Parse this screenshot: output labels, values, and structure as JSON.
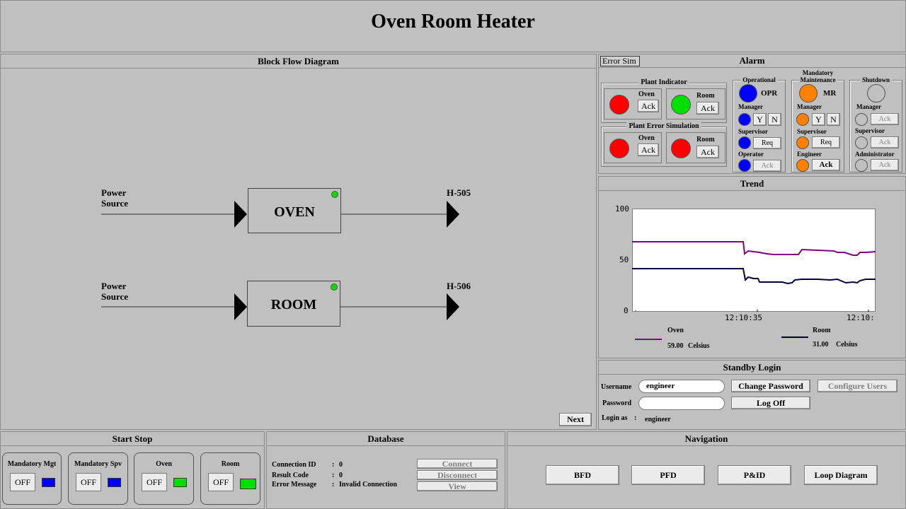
{
  "title": "Oven Room Heater",
  "bfd": {
    "title": "Block Flow Diagram",
    "line1": {
      "source_line1": "Power",
      "source_line2": "Source",
      "block": "OVEN",
      "tag": "H-505"
    },
    "line2": {
      "source_line1": "Power",
      "source_line2": "Source",
      "block": "ROOM",
      "tag": "H-506"
    },
    "next_label": "Next"
  },
  "alarm": {
    "title": "Alarm",
    "error_sim_tab": "Error Sim",
    "plant_indicator": {
      "title": "Plant Indicator",
      "oven": "Oven",
      "room": "Room",
      "ack": "Ack"
    },
    "plant_error_simulation": {
      "title": "Plant Error Simulation",
      "oven": "Oven",
      "room": "Room",
      "ack": "Ack"
    },
    "operational": {
      "title": "Operational",
      "code": "OPR",
      "manager": "Manager",
      "supervisor": "Supervisor",
      "operator": "Operator",
      "y": "Y",
      "n": "N",
      "req": "Req",
      "ack": "Ack"
    },
    "mandatory": {
      "title_line1": "Mandatory",
      "title_line2": "Maintenance",
      "code": "MR",
      "manager": "Manager",
      "supervisor": "Supervisor",
      "engineer": "Engineer",
      "y": "Y",
      "n": "N",
      "req": "Req",
      "ack": "Ack"
    },
    "shutdown": {
      "title": "Shutdown",
      "manager": "Manager",
      "supervisor": "Supervisor",
      "administrator": "Administrator",
      "ack": "Ack"
    },
    "colors": {
      "red": "#ff0000",
      "green": "#00e000",
      "blue": "#0000ff",
      "orange": "#ff8000",
      "grey": "#c0c0c0"
    }
  },
  "trend": {
    "title": "Trend",
    "y_ticks": [
      "100",
      "50",
      "0"
    ],
    "x_ticks": [
      "12:10:35",
      "12:10:"
    ],
    "legend": {
      "oven_label": "Oven",
      "oven_value": "59.00",
      "oven_unit": "Celsius",
      "room_label": "Room",
      "room_value": "31.00",
      "room_unit": "Celsius"
    },
    "colors": {
      "oven": "#800080",
      "room": "#000040"
    }
  },
  "login": {
    "title": "Standby Login",
    "username_label": "Username",
    "username_value": "engineer",
    "password_label": "Password",
    "password_value": "",
    "change_password": "Change Password",
    "configure_users": "Configure Users",
    "log_off": "Log Off",
    "login_as_label": "Login as",
    "login_as_sep": ":",
    "login_as_value": "engineer"
  },
  "start_stop": {
    "title": "Start Stop",
    "items": [
      {
        "label": "Mandatory Mgt",
        "off": "OFF"
      },
      {
        "label": "Mandatory Spv",
        "off": "OFF"
      },
      {
        "label": "Oven",
        "off": "OFF"
      },
      {
        "label": "Room",
        "off": "OFF"
      }
    ]
  },
  "database": {
    "title": "Database",
    "connection_id_label": "Connection ID",
    "connection_id_value": "0",
    "result_code_label": "Result Code",
    "result_code_value": "0",
    "error_message_label": "Error Message",
    "error_message_value": "Invalid Connection",
    "sep": ":",
    "connect": "Connect",
    "disconnect": "Disconnect",
    "view": "View"
  },
  "navigation": {
    "title": "Navigation",
    "bfd": "BFD",
    "pfd": "PFD",
    "pid": "P&ID",
    "loop": "Loop Diagram"
  }
}
